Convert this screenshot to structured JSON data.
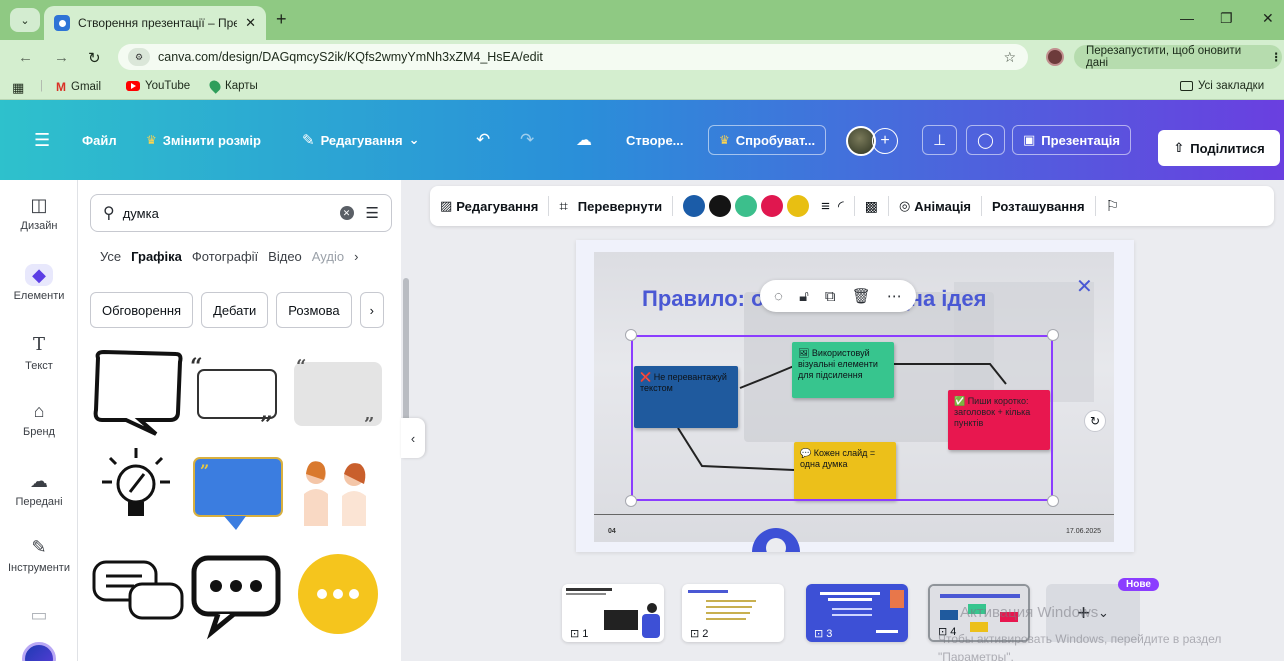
{
  "browser": {
    "tab_title": "Створення презентації – Презе",
    "url": "canva.com/design/DAGqmcyS2ik/KQfs2wmyYmNh3xZM4_HsEA/edit",
    "relaunch_label": "Перезапустити, щоб оновити дані",
    "bookmarks": [
      "Gmail",
      "YouTube",
      "Карты"
    ],
    "all_bookmarks_label": "Усі закладки"
  },
  "header": {
    "file": "Файл",
    "resize": "Змінити розмір",
    "editing": "Редагування",
    "doc_title": "Створе...",
    "try_pro": "Спробуват...",
    "present": "Презентація",
    "share": "Поділитися",
    "accent": "#8b3dff"
  },
  "rail": {
    "items": [
      {
        "label": "Дизайн",
        "icon": "layout-icon"
      },
      {
        "label": "Елементи",
        "icon": "shapes-icon"
      },
      {
        "label": "Текст",
        "icon": "text-icon"
      },
      {
        "label": "Бренд",
        "icon": "brand-icon"
      },
      {
        "label": "Передані",
        "icon": "uploads-icon"
      },
      {
        "label": "Інструменти",
        "icon": "tools-icon"
      }
    ]
  },
  "panel": {
    "search_value": "думка",
    "tabs": [
      "Усе",
      "Графіка",
      "Фотографії",
      "Відео",
      "Аудіо"
    ],
    "active_tab": "Графіка",
    "chips": [
      "Обговорення",
      "Дебати",
      "Розмова"
    ]
  },
  "toolbar": {
    "edit": "Редагування",
    "flip": "Перевернути",
    "colors": [
      "#1b5ca8",
      "#141414",
      "#3cbf8c",
      "#e0174f",
      "#e8bf12"
    ],
    "animation": "Анімація",
    "position": "Розташування"
  },
  "slide": {
    "title_left": "Правило: о",
    "title_right": "одна ідея",
    "number": "04",
    "date": "17.06.2025",
    "notes": [
      {
        "text": "❌ Не перевантажуй текстом",
        "color": "#1f5a9e"
      },
      {
        "text": "🖼 Використовуй візуальні елементи для підсилення",
        "color": "#37c58e"
      },
      {
        "text": "✅ Пиши коротко: заголовок + кілька пунктів",
        "color": "#e8174f"
      },
      {
        "text": "💬 Кожен слайд = одна думка",
        "color": "#ecc01a"
      }
    ]
  },
  "thumbs": {
    "labels": [
      "1",
      "2",
      "3",
      "4"
    ],
    "new_badge": "Нове"
  },
  "watermark": {
    "line1": "Активация Windows",
    "line2": "Чтобы активировать Windows, перейдите в раздел \"Параметры\"."
  }
}
